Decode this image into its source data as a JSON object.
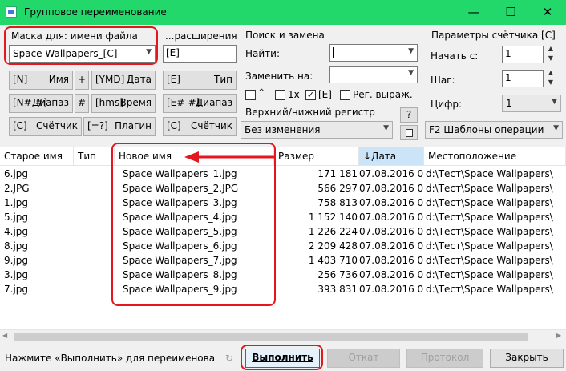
{
  "window": {
    "title": "Групповое переименование",
    "minimize_glyph": "—",
    "maximize_glyph": "☐",
    "close_glyph": "✕"
  },
  "mask_group": {
    "title": "Маска для: имени файла",
    "value": "Space Wallpapers_[C]",
    "buttons": [
      {
        "left": "[N]",
        "right": "Имя"
      },
      {
        "left": "+",
        "right": ""
      },
      {
        "left": "[YMD]",
        "right": "Дата"
      },
      {
        "left": "[N#-#]",
        "right": "Диапаз"
      },
      {
        "left": "#",
        "right": ""
      },
      {
        "left": "[hms]",
        "right": "Время"
      },
      {
        "left": "[C]",
        "right": "Счётчик"
      },
      {
        "left": "[=?]",
        "right": "Плагин"
      }
    ]
  },
  "ext_group": {
    "title": "...расширения",
    "value": "[E]",
    "buttons": [
      {
        "left": "[E]",
        "right": "Тип"
      },
      {
        "left": "[E#-#]",
        "right": "Диапаз"
      },
      {
        "left": "[C]",
        "right": "Счётчик"
      }
    ]
  },
  "search_group": {
    "title": "Поиск и замена",
    "find_label": "Найти:",
    "replace_label": "Заменить на:",
    "opt_regex_first": "^",
    "opt_1x": "1x",
    "opt_e": "[E]",
    "opt_regex": "Рег. выраж."
  },
  "case_group": {
    "title": "Верхний/нижний регистр",
    "value": "Без изменения",
    "help": "?"
  },
  "counter_group": {
    "title": "Параметры счётчика [C]",
    "start_label": "Начать с:",
    "start_value": "1",
    "step_label": "Шаг:",
    "step_value": "1",
    "digits_label": "Цифр:",
    "digits_value": "1"
  },
  "templates_button": "F2 Шаблоны операции",
  "columns": [
    "Старое имя",
    "Тип",
    "Новое имя",
    "Размер",
    "Дата",
    "Местоположение"
  ],
  "sort_arrow": "↓",
  "rows": [
    {
      "old": "6.jpg",
      "new": "Space Wallpapers_1.jpg",
      "size": "171 181",
      "date": "07.08.2016 0...",
      "path": "d:\\Тест\\Space Wallpapers\\"
    },
    {
      "old": "2.JPG",
      "new": "Space Wallpapers_2.JPG",
      "size": "566 297",
      "date": "07.08.2016 0...",
      "path": "d:\\Тест\\Space Wallpapers\\"
    },
    {
      "old": "1.jpg",
      "new": "Space Wallpapers_3.jpg",
      "size": "758 813",
      "date": "07.08.2016 0...",
      "path": "d:\\Тест\\Space Wallpapers\\"
    },
    {
      "old": "5.jpg",
      "new": "Space Wallpapers_4.jpg",
      "size": "1 152 140",
      "date": "07.08.2016 0...",
      "path": "d:\\Тест\\Space Wallpapers\\"
    },
    {
      "old": "4.jpg",
      "new": "Space Wallpapers_5.jpg",
      "size": "1 226 224",
      "date": "07.08.2016 0...",
      "path": "d:\\Тест\\Space Wallpapers\\"
    },
    {
      "old": "8.jpg",
      "new": "Space Wallpapers_6.jpg",
      "size": "2 209 428",
      "date": "07.08.2016 0...",
      "path": "d:\\Тест\\Space Wallpapers\\"
    },
    {
      "old": "9.jpg",
      "new": "Space Wallpapers_7.jpg",
      "size": "1 403 710",
      "date": "07.08.2016 0...",
      "path": "d:\\Тест\\Space Wallpapers\\"
    },
    {
      "old": "3.jpg",
      "new": "Space Wallpapers_8.jpg",
      "size": "256 736",
      "date": "07.08.2016 0...",
      "path": "d:\\Тест\\Space Wallpapers\\"
    },
    {
      "old": "7.jpg",
      "new": "Space Wallpapers_9.jpg",
      "size": "393 831",
      "date": "07.08.2016 0...",
      "path": "d:\\Тест\\Space Wallpapers\\"
    }
  ],
  "status": {
    "text": "Нажмите «Выполнить» для переименования",
    "run": "Выполнить",
    "undo": "Откат",
    "log": "Протокол",
    "close": "Закрыть"
  },
  "colors": {
    "titlebar": "#22d86b",
    "highlight": "#e3171d",
    "sorted_header": "#cce4f7"
  }
}
